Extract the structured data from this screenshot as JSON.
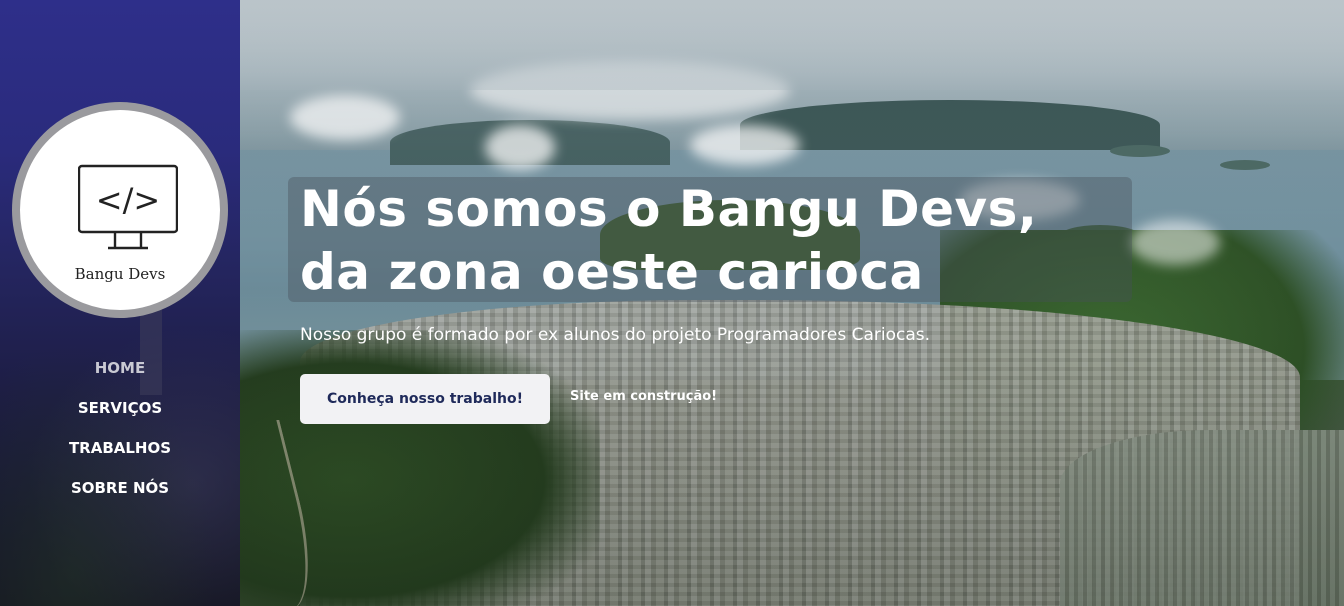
{
  "brand": {
    "name": "Bangu Devs",
    "logo_icon": "code-monitor-icon",
    "logo_symbol": "</>"
  },
  "nav": {
    "items": [
      {
        "label": "HOME",
        "active": true
      },
      {
        "label": "SERVIÇOS",
        "active": false
      },
      {
        "label": "TRABALHOS",
        "active": false
      },
      {
        "label": "SOBRE NÓS",
        "active": false
      }
    ]
  },
  "hero": {
    "title_line1": "Nós somos o Bangu Devs,",
    "title_line2": "da zona oeste carioca",
    "subtitle": "Nosso grupo é formado por ex alunos do projeto Programadores Cariocas.",
    "cta_label": "Conheça nosso trabalho!",
    "construction_note": "Site em construção!"
  },
  "colors": {
    "sidebar_top": "#2e2f8a",
    "sidebar_bottom": "#141522",
    "cta_background": "#f2f2f4",
    "cta_text": "#1f2a5a",
    "logo_ring": "#9a9a9e"
  }
}
